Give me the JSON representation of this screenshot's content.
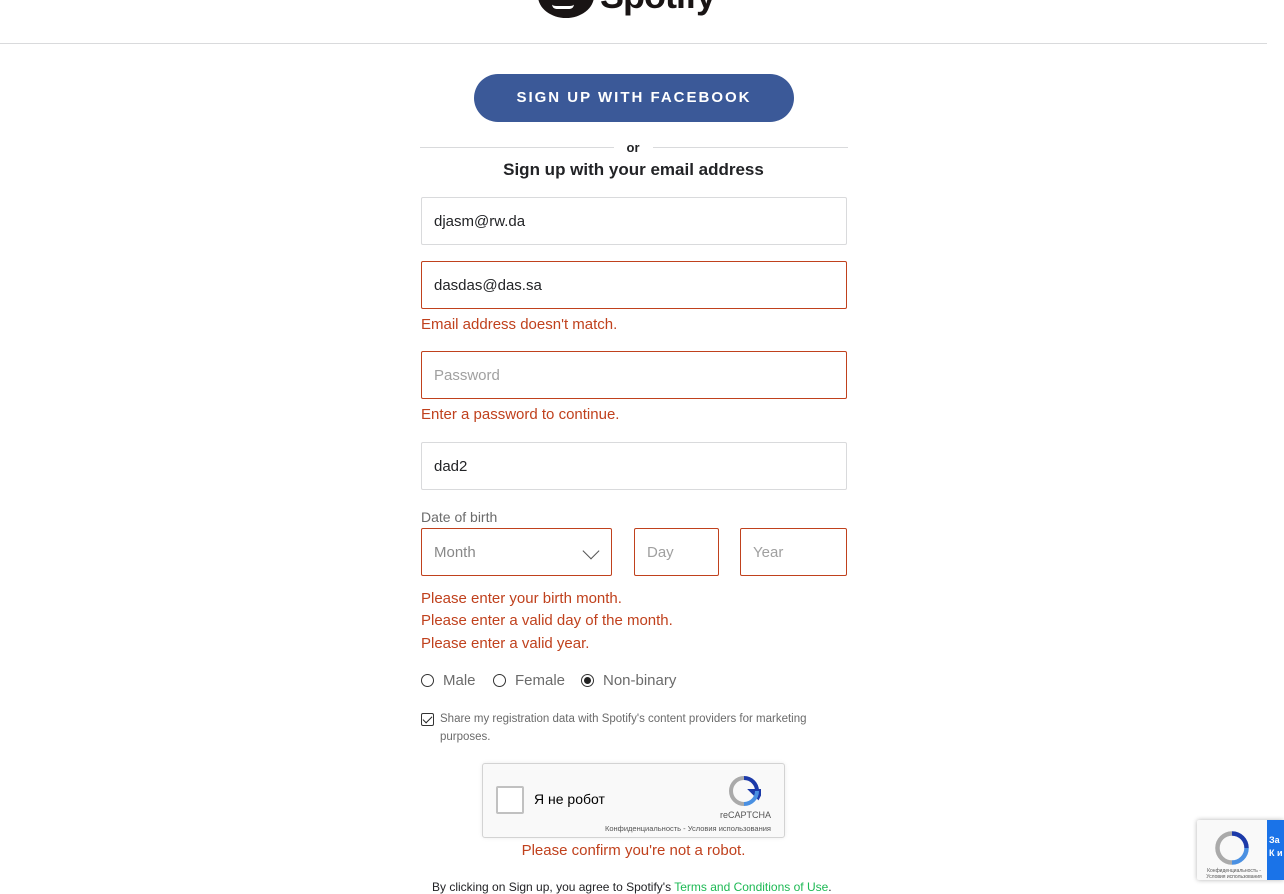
{
  "header": {
    "brand": "Spotify"
  },
  "facebook_button": {
    "label": "SIGN UP WITH FACEBOOK",
    "color": "#3b5998"
  },
  "divider": {
    "label": "or"
  },
  "email_section": {
    "title": "Sign up with your email address"
  },
  "fields": {
    "email": {
      "value": "djasm@rw.da"
    },
    "confirm_email": {
      "value": "dasdas@das.sa",
      "error": "Email address doesn't match."
    },
    "password": {
      "placeholder": "Password",
      "error": "Enter a password to continue."
    },
    "display_name": {
      "value": "dad2"
    }
  },
  "dob": {
    "label": "Date of birth",
    "month_placeholder": "Month",
    "day_placeholder": "Day",
    "year_placeholder": "Year",
    "errors": [
      "Please enter your birth month.",
      "Please enter a valid day of the month.",
      "Please enter a valid year."
    ]
  },
  "gender": {
    "options": [
      "Male",
      "Female",
      "Non-binary"
    ],
    "selected": "Non-binary"
  },
  "share": {
    "checked": true,
    "label": "Share my registration data with Spotify's content providers for marketing purposes."
  },
  "recaptcha": {
    "label": "Я не робот",
    "brand": "reCAPTCHA",
    "links": "Конфиденциальность - Условия использования",
    "error": "Please confirm you're not a robot."
  },
  "terms": {
    "prefix": "By clicking on Sign up, you agree to Spotify's ",
    "link": "Terms and Conditions of Use",
    "suffix": "."
  },
  "recaptcha_badge": {
    "links": "Конфиденциальность - Условия использования",
    "side_text": "За К и"
  },
  "colors": {
    "error": "#c0411d",
    "link": "#1db954",
    "facebook": "#3b5998"
  }
}
